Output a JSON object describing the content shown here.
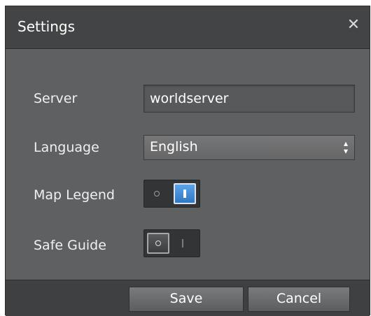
{
  "dialog": {
    "title": "Settings",
    "close_label": "✕"
  },
  "fields": {
    "server": {
      "label": "Server",
      "value": "worldserver"
    },
    "language": {
      "label": "Language",
      "selected": "English"
    },
    "map_legend": {
      "label": "Map Legend",
      "state": "on"
    },
    "safe_guide": {
      "label": "Safe Guide",
      "state": "off"
    }
  },
  "footer": {
    "save_label": "Save",
    "cancel_label": "Cancel"
  },
  "colors": {
    "accent": "#3d8ad8",
    "dialog_bg": "#5f6061",
    "titlebar_bg": "#434445"
  }
}
